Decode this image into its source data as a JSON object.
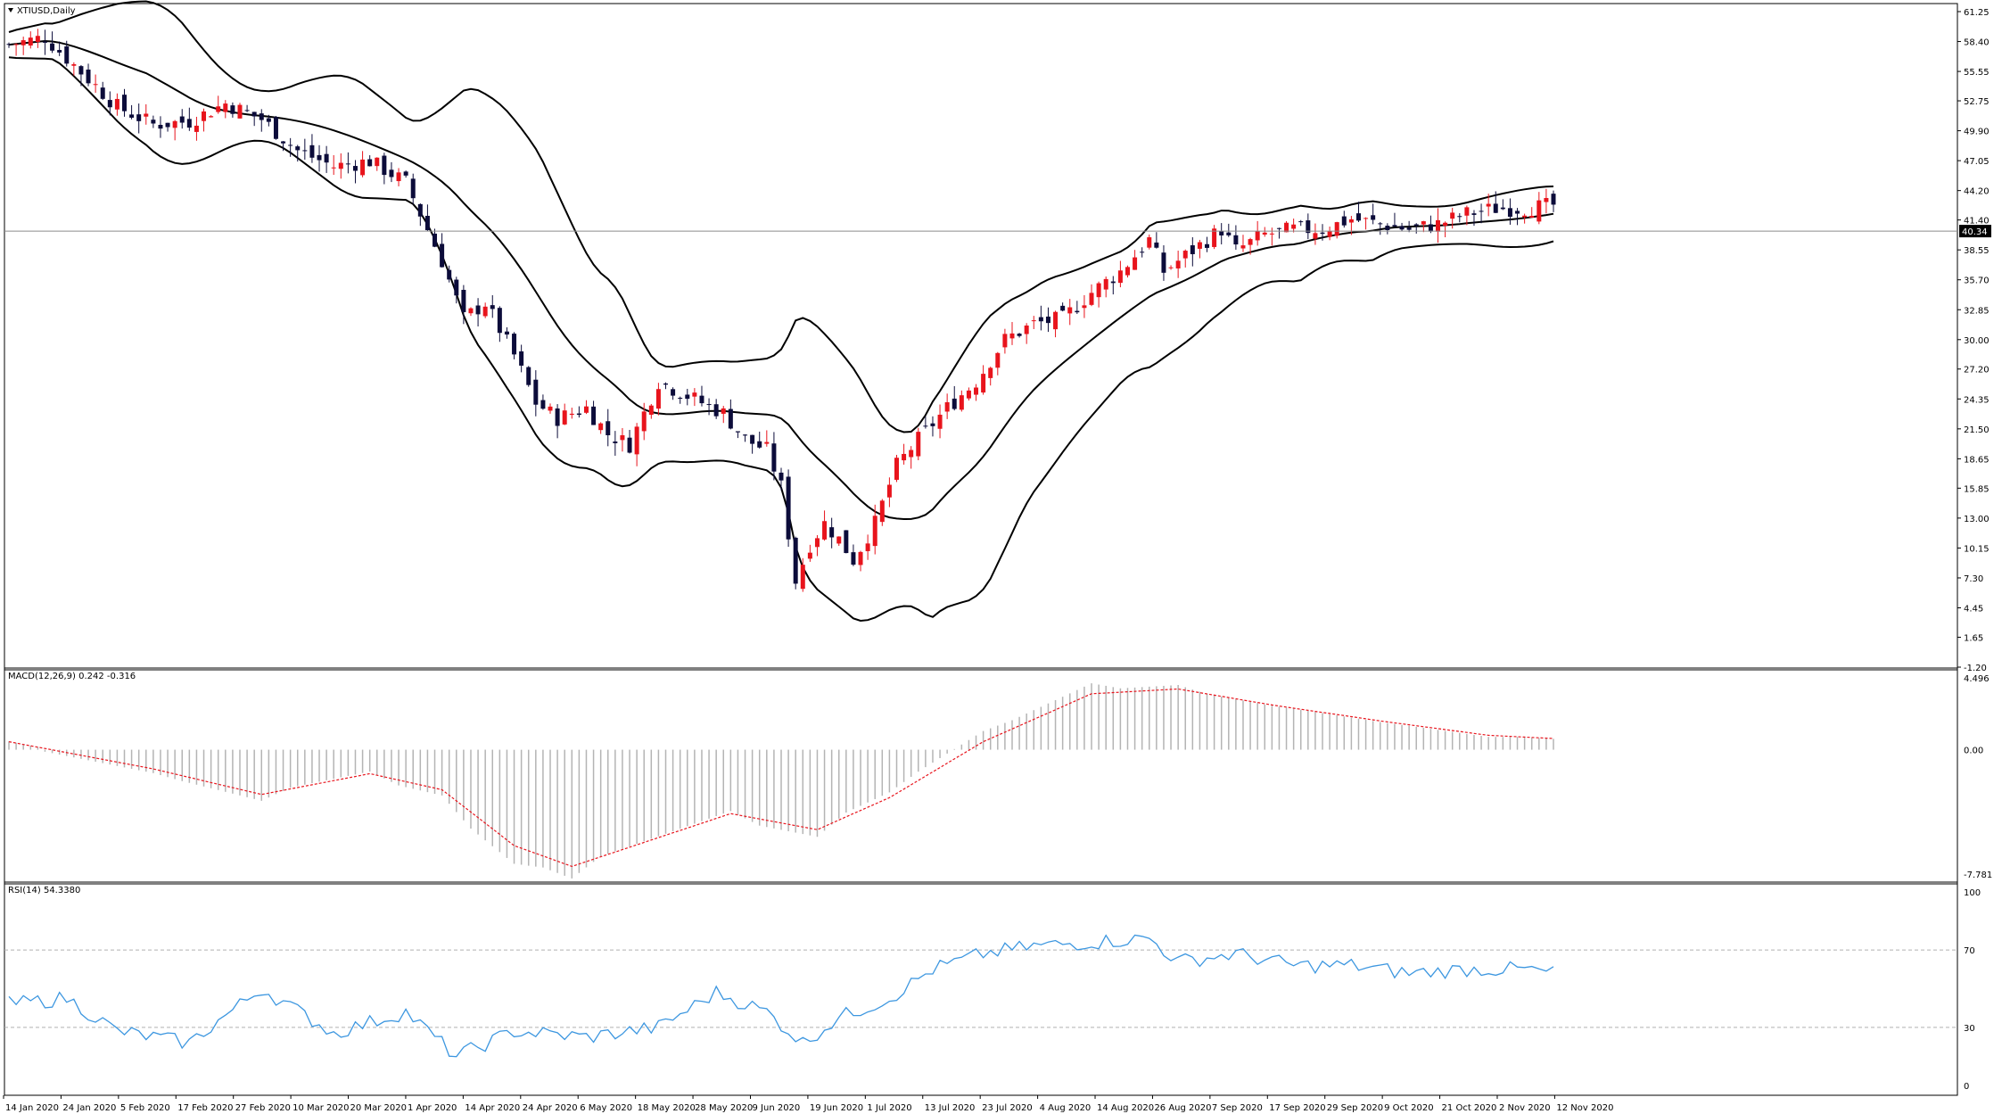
{
  "symbol_title": "XTIUSD,Daily",
  "last_price_label": "40.34",
  "colors": {
    "bull": "#e8141c",
    "bear": "#0c0c3a",
    "band": "#000000",
    "macd_hist": "#b4b4b4",
    "macd_signal": "#e8141c",
    "rsi_line": "#3d97e0",
    "level_line": "#b0b0b0",
    "price_line": "#8c8c8c",
    "axis": "#000000"
  },
  "price_axis_labels": [
    "61.25",
    "58.40",
    "55.55",
    "52.75",
    "49.90",
    "47.05",
    "44.20",
    "41.40",
    "38.55",
    "35.70",
    "32.85",
    "30.00",
    "27.20",
    "24.35",
    "21.50",
    "18.65",
    "15.85",
    "13.00",
    "10.15",
    "7.30",
    "4.45",
    "1.65",
    "-1.20"
  ],
  "macd": {
    "title": "MACD(12,26,9) 0.242 -0.316",
    "axis_labels": [
      "4.496",
      "0.00",
      "-7.781"
    ]
  },
  "rsi": {
    "title": "RSI(14) 54.3380",
    "axis_labels": [
      "100",
      "70",
      "30",
      "0"
    ]
  },
  "date_labels": [
    "14 Jan 2020",
    "24 Jan 2020",
    "5 Feb 2020",
    "17 Feb 2020",
    "27 Feb 2020",
    "10 Mar 2020",
    "20 Mar 2020",
    "1 Apr 2020",
    "14 Apr 2020",
    "24 Apr 2020",
    "6 May 2020",
    "18 May 2020",
    "28 May 2020",
    "9 Jun 2020",
    "19 Jun 2020",
    "1 Jul 2020",
    "13 Jul 2020",
    "23 Jul 2020",
    "4 Aug 2020",
    "14 Aug 2020",
    "26 Aug 2020",
    "7 Sep 2020",
    "17 Sep 2020",
    "29 Sep 2020",
    "9 Oct 2020",
    "21 Oct 2020",
    "2 Nov 2020",
    "12 Nov 2020"
  ],
  "chart_data": {
    "type": "candlestick",
    "title": "XTIUSD,Daily",
    "ylim": [
      -1.2,
      61.25
    ],
    "bar_count": 215,
    "last_price": 40.34,
    "close_series": [
      {
        "i": 0,
        "c": 58.1
      },
      {
        "i": 5,
        "c": 58.8
      },
      {
        "i": 10,
        "c": 55.5
      },
      {
        "i": 15,
        "c": 52.2
      },
      {
        "i": 20,
        "c": 50.5
      },
      {
        "i": 25,
        "c": 50.8
      },
      {
        "i": 30,
        "c": 52.5
      },
      {
        "i": 35,
        "c": 51.0
      },
      {
        "i": 40,
        "c": 48.0
      },
      {
        "i": 45,
        "c": 46.5
      },
      {
        "i": 50,
        "c": 47.0
      },
      {
        "i": 55,
        "c": 45.0
      },
      {
        "i": 60,
        "c": 37.5
      },
      {
        "i": 63,
        "c": 32.0
      },
      {
        "i": 66,
        "c": 33.5
      },
      {
        "i": 70,
        "c": 28.5
      },
      {
        "i": 73,
        "c": 24.0
      },
      {
        "i": 76,
        "c": 22.5
      },
      {
        "i": 80,
        "c": 23.5
      },
      {
        "i": 83,
        "c": 21.0
      },
      {
        "i": 86,
        "c": 20.0
      },
      {
        "i": 88,
        "c": 23.0
      },
      {
        "i": 90,
        "c": 26.0
      },
      {
        "i": 93,
        "c": 25.0
      },
      {
        "i": 96,
        "c": 24.0
      },
      {
        "i": 99,
        "c": 23.0
      },
      {
        "i": 102,
        "c": 20.5
      },
      {
        "i": 105,
        "c": 19.5
      },
      {
        "i": 107,
        "c": 16.0
      },
      {
        "i": 109,
        "c": 7.0
      },
      {
        "i": 111,
        "c": 10.5
      },
      {
        "i": 113,
        "c": 12.5
      },
      {
        "i": 115,
        "c": 11.0
      },
      {
        "i": 117,
        "c": 9.0
      },
      {
        "i": 120,
        "c": 12.5
      },
      {
        "i": 123,
        "c": 18.0
      },
      {
        "i": 126,
        "c": 20.5
      },
      {
        "i": 130,
        "c": 23.5
      },
      {
        "i": 134,
        "c": 26.0
      },
      {
        "i": 138,
        "c": 30.0
      },
      {
        "i": 142,
        "c": 31.5
      },
      {
        "i": 146,
        "c": 32.0
      },
      {
        "i": 150,
        "c": 34.5
      },
      {
        "i": 154,
        "c": 36.5
      },
      {
        "i": 158,
        "c": 39.5
      },
      {
        "i": 160,
        "c": 36.5
      },
      {
        "i": 164,
        "c": 38.5
      },
      {
        "i": 168,
        "c": 40.5
      },
      {
        "i": 170,
        "c": 38.5
      },
      {
        "i": 174,
        "c": 40.0
      },
      {
        "i": 178,
        "c": 40.5
      },
      {
        "i": 182,
        "c": 40.5
      },
      {
        "i": 186,
        "c": 41.5
      },
      {
        "i": 190,
        "c": 41.0
      },
      {
        "i": 194,
        "c": 40.5
      },
      {
        "i": 198,
        "c": 41.0
      },
      {
        "i": 202,
        "c": 42.0
      },
      {
        "i": 206,
        "c": 42.5
      },
      {
        "i": 210,
        "c": 42.5
      },
      {
        "i": 214,
        "c": 42.8
      }
    ],
    "macd_signal_series": [
      {
        "i": 0,
        "v": 0.5
      },
      {
        "i": 20,
        "v": -1.2
      },
      {
        "i": 35,
        "v": -2.8
      },
      {
        "i": 50,
        "v": -1.5
      },
      {
        "i": 60,
        "v": -2.5
      },
      {
        "i": 70,
        "v": -6.0
      },
      {
        "i": 78,
        "v": -7.3
      },
      {
        "i": 90,
        "v": -5.5
      },
      {
        "i": 100,
        "v": -4.0
      },
      {
        "i": 112,
        "v": -5.0
      },
      {
        "i": 122,
        "v": -3.0
      },
      {
        "i": 135,
        "v": 0.5
      },
      {
        "i": 150,
        "v": 3.5
      },
      {
        "i": 162,
        "v": 3.8
      },
      {
        "i": 175,
        "v": 2.8
      },
      {
        "i": 190,
        "v": 1.8
      },
      {
        "i": 205,
        "v": 0.9
      },
      {
        "i": 214,
        "v": 0.7
      }
    ],
    "rsi_series": [
      {
        "i": 0,
        "v": 42
      },
      {
        "i": 8,
        "v": 45
      },
      {
        "i": 15,
        "v": 28
      },
      {
        "i": 25,
        "v": 22
      },
      {
        "i": 35,
        "v": 50
      },
      {
        "i": 45,
        "v": 27
      },
      {
        "i": 55,
        "v": 38
      },
      {
        "i": 62,
        "v": 15
      },
      {
        "i": 70,
        "v": 28
      },
      {
        "i": 80,
        "v": 25
      },
      {
        "i": 90,
        "v": 30
      },
      {
        "i": 98,
        "v": 48
      },
      {
        "i": 105,
        "v": 38
      },
      {
        "i": 110,
        "v": 22
      },
      {
        "i": 115,
        "v": 35
      },
      {
        "i": 122,
        "v": 45
      },
      {
        "i": 128,
        "v": 60
      },
      {
        "i": 135,
        "v": 68
      },
      {
        "i": 142,
        "v": 72
      },
      {
        "i": 150,
        "v": 74
      },
      {
        "i": 158,
        "v": 76
      },
      {
        "i": 162,
        "v": 64
      },
      {
        "i": 170,
        "v": 68
      },
      {
        "i": 178,
        "v": 62
      },
      {
        "i": 186,
        "v": 62
      },
      {
        "i": 194,
        "v": 58
      },
      {
        "i": 202,
        "v": 60
      },
      {
        "i": 210,
        "v": 60
      },
      {
        "i": 214,
        "v": 58
      }
    ],
    "rsi_levels": [
      70,
      30
    ],
    "grid": false
  }
}
